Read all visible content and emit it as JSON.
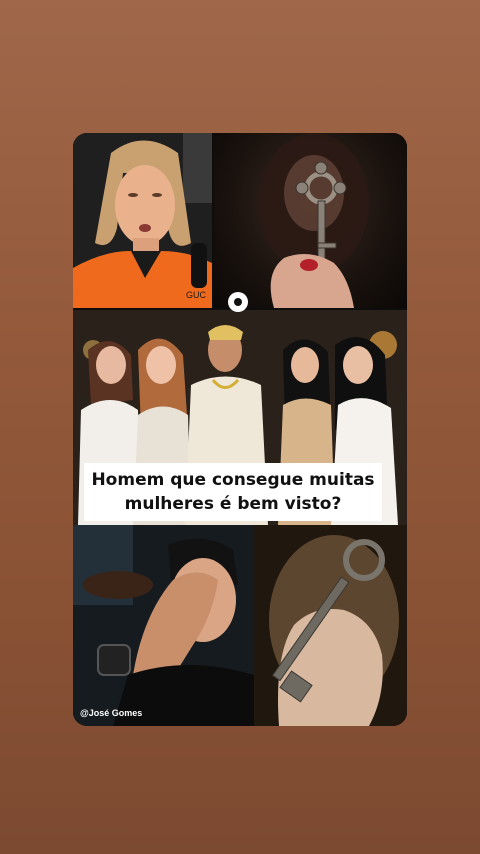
{
  "overlay": {
    "line1": "Homem que consegue muitas",
    "line2": "mulheres é bem visto?"
  },
  "credit": "@José Gomes",
  "shirt_brand": "GUC",
  "colors": {
    "background": "#93593a",
    "overlay_bg": "#ffffff",
    "shirt": "#f06a1e"
  }
}
